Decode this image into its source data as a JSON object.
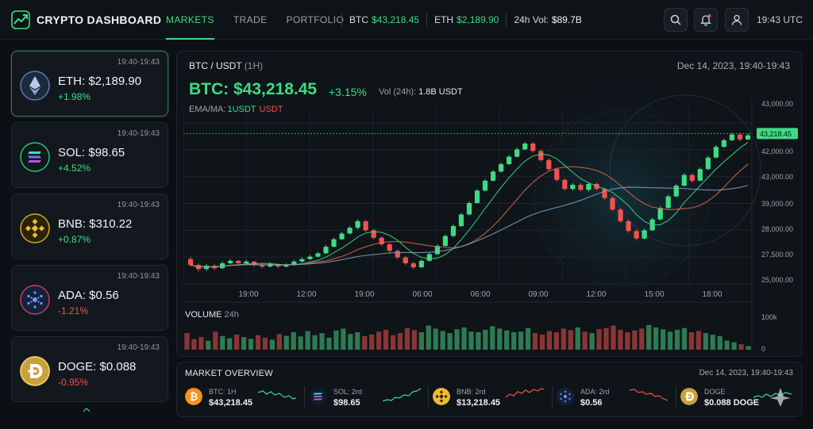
{
  "brand": {
    "title": "CRYPTO DASHBOARD"
  },
  "nav": [
    {
      "label": "MARKETS",
      "active": true
    },
    {
      "label": "TRADE"
    },
    {
      "label": "PORTFOLIO"
    }
  ],
  "ticker": {
    "btc_label": "BTC",
    "btc_value": "$43,218.45",
    "eth_label": "ETH",
    "eth_value": "$2,189.90",
    "vol_label": "24h Vol:",
    "vol_value": "$89.7B"
  },
  "header": {
    "search_icon": "search-icon",
    "bell_icon": "bell-icon",
    "user_icon": "user-icon",
    "time": "19:43 UTC"
  },
  "sidebar": {
    "cards": [
      {
        "time": "19:40-19:43",
        "name": "ETH: $2,189.90",
        "change": "+1.98%",
        "dir": "up",
        "icon": "ethereum-icon"
      },
      {
        "time": "19:40-19:43",
        "name": "SOL: $98.65",
        "change": "+4.52%",
        "dir": "up",
        "icon": "solana-icon"
      },
      {
        "time": "19:40-19:43",
        "name": "BNB: $310.22",
        "change": "+0.87%",
        "dir": "up",
        "icon": "bnb-icon"
      },
      {
        "time": "19:40-19:43",
        "name": "ADA: $0.56",
        "change": "-1.21%",
        "dir": "down",
        "icon": "cardano-icon"
      },
      {
        "time": "19:40-19:43",
        "name": "DOGE: $0.088",
        "change": "-0.95%",
        "dir": "down",
        "icon": "dogecoin-icon"
      }
    ]
  },
  "main": {
    "pair": "BTC / USDT",
    "timeframe": "(1H)",
    "date": "Dec 14, 2023, 19:40-19:43",
    "price": "BTC: $43,218.45",
    "change": "+3.15%",
    "vol_label": "Vol (24h):",
    "vol_value": "1.8B USDT",
    "ema_label": "EMA/MA:",
    "ema_a": "1USDT",
    "ema_b": "USDT"
  },
  "volume": {
    "label": "VOLUME",
    "span": "24h"
  },
  "chart_data": {
    "type": "candlestick",
    "x_ticks": [
      "19:00",
      "12:00",
      "19:00",
      "06:00",
      "06:00",
      "09:00",
      "12:00",
      "15:00",
      "18:00"
    ],
    "y_ticks": [
      "43,000.00",
      "42,000.00",
      "43,000.00",
      "39,000.00",
      "28,000.00",
      "27,500.00",
      "25,000.00"
    ],
    "current_price_label": "43,218.45",
    "volume_ticks": [
      "100k",
      "0"
    ],
    "ohlc": [
      [
        28000,
        27300,
        28300,
        27100
      ],
      [
        27300,
        26800,
        27500,
        26500
      ],
      [
        26800,
        27200,
        27400,
        26600
      ],
      [
        27200,
        26900,
        27400,
        26700
      ],
      [
        26900,
        27500,
        27700,
        26800
      ],
      [
        27500,
        27800,
        28000,
        27400
      ],
      [
        27800,
        27500,
        27900,
        27300
      ],
      [
        27500,
        27700,
        27900,
        27300
      ],
      [
        27700,
        27300,
        27800,
        27100
      ],
      [
        27300,
        27100,
        27500,
        26900
      ],
      [
        27100,
        27400,
        27600,
        27000
      ],
      [
        27400,
        27100,
        27500,
        26900
      ],
      [
        27100,
        27300,
        27500,
        27000
      ],
      [
        27300,
        27700,
        27900,
        27200
      ],
      [
        27700,
        28000,
        28200,
        27600
      ],
      [
        28000,
        28300,
        28500,
        27900
      ],
      [
        28300,
        28700,
        28900,
        28200
      ],
      [
        28700,
        29500,
        29700,
        28600
      ],
      [
        29500,
        30400,
        30600,
        29400
      ],
      [
        30400,
        31100,
        31300,
        30300
      ],
      [
        31100,
        31800,
        32000,
        31000
      ],
      [
        31800,
        32600,
        32800,
        31600
      ],
      [
        32600,
        31500,
        32700,
        31300
      ],
      [
        31500,
        30600,
        31700,
        30400
      ],
      [
        30600,
        29800,
        30800,
        29600
      ],
      [
        29800,
        29000,
        30000,
        28800
      ],
      [
        29000,
        28200,
        29200,
        28000
      ],
      [
        28200,
        27500,
        28400,
        27300
      ],
      [
        27500,
        27000,
        27700,
        26800
      ],
      [
        27000,
        27800,
        28000,
        26900
      ],
      [
        27800,
        28600,
        28800,
        27700
      ],
      [
        28600,
        29600,
        29800,
        28500
      ],
      [
        29600,
        30800,
        31000,
        29500
      ],
      [
        30800,
        32000,
        32200,
        30700
      ],
      [
        32000,
        33400,
        33600,
        31900
      ],
      [
        33400,
        34800,
        35000,
        33300
      ],
      [
        34800,
        36300,
        36500,
        34700
      ],
      [
        36300,
        37500,
        37700,
        36200
      ],
      [
        37500,
        38600,
        38800,
        37400
      ],
      [
        38600,
        39500,
        39700,
        38500
      ],
      [
        39500,
        40400,
        40600,
        39400
      ],
      [
        40400,
        41300,
        41500,
        40300
      ],
      [
        41300,
        42000,
        42200,
        41200
      ],
      [
        42000,
        41100,
        42200,
        40900
      ],
      [
        41100,
        40000,
        41300,
        39800
      ],
      [
        40000,
        38900,
        40200,
        38700
      ],
      [
        38900,
        37600,
        39100,
        37400
      ],
      [
        37600,
        36500,
        37800,
        36300
      ],
      [
        36500,
        37000,
        37200,
        36300
      ],
      [
        37000,
        36400,
        37200,
        36200
      ],
      [
        36400,
        37100,
        37300,
        36200
      ],
      [
        37100,
        36500,
        37300,
        36300
      ],
      [
        36500,
        35400,
        36700,
        35200
      ],
      [
        35400,
        34000,
        35600,
        33800
      ],
      [
        34000,
        32600,
        34200,
        32400
      ],
      [
        32600,
        31400,
        32800,
        31200
      ],
      [
        31400,
        30500,
        31600,
        30300
      ],
      [
        30500,
        31500,
        31700,
        30400
      ],
      [
        31500,
        32800,
        33000,
        31400
      ],
      [
        32800,
        34200,
        34400,
        32700
      ],
      [
        34200,
        35600,
        35800,
        34100
      ],
      [
        35600,
        36900,
        37100,
        35500
      ],
      [
        36900,
        38200,
        38400,
        36800
      ],
      [
        38200,
        37500,
        38400,
        37300
      ],
      [
        37500,
        38900,
        39100,
        37400
      ],
      [
        38900,
        40300,
        40500,
        38800
      ],
      [
        40300,
        41600,
        41800,
        40200
      ],
      [
        41600,
        42400,
        42600,
        41500
      ],
      [
        42400,
        43100,
        43300,
        42300
      ],
      [
        43100,
        42500,
        43300,
        42300
      ],
      [
        42500,
        43000,
        43200,
        42400
      ]
    ],
    "volume": [
      55,
      35,
      42,
      30,
      60,
      45,
      38,
      50,
      42,
      36,
      48,
      40,
      33,
      52,
      46,
      58,
      44,
      62,
      48,
      55,
      40,
      64,
      70,
      52,
      58,
      45,
      50,
      60,
      66,
      48,
      55,
      72,
      65,
      58,
      80,
      70,
      62,
      55,
      68,
      74,
      60,
      58,
      66,
      78,
      70,
      64,
      58,
      60,
      72,
      55,
      50,
      62,
      58,
      70,
      65,
      74,
      60,
      55,
      68,
      72,
      80,
      66,
      58,
      64,
      70,
      82,
      74,
      68,
      60,
      66,
      72,
      58,
      62,
      55,
      50,
      45,
      30,
      25,
      18,
      12
    ]
  },
  "overview": {
    "title": "MARKET OVERVIEW",
    "date": "Dec 14, 2023, 19:40-19:43",
    "items": [
      {
        "label": "BTC: 1H",
        "value": "$43,218.45",
        "icon": "bitcoin-icon",
        "trend": "up"
      },
      {
        "label": "SOL: 2rd",
        "value": "$98.65",
        "icon": "solana-icon",
        "trend": "up"
      },
      {
        "label": "BNB: 2rd",
        "value": "$13,218.45",
        "icon": "bnb-icon",
        "trend": "down"
      },
      {
        "label": "ADA: 2rd",
        "value": "$0.56",
        "icon": "cardano-icon",
        "trend": "down"
      },
      {
        "label": "DOGE",
        "value": "$0.088 DOGE",
        "icon": "dogecoin-icon",
        "trend": "up"
      }
    ]
  },
  "colors": {
    "up": "#3ddc84",
    "down": "#f0524f",
    "bg": "#0c1015"
  }
}
